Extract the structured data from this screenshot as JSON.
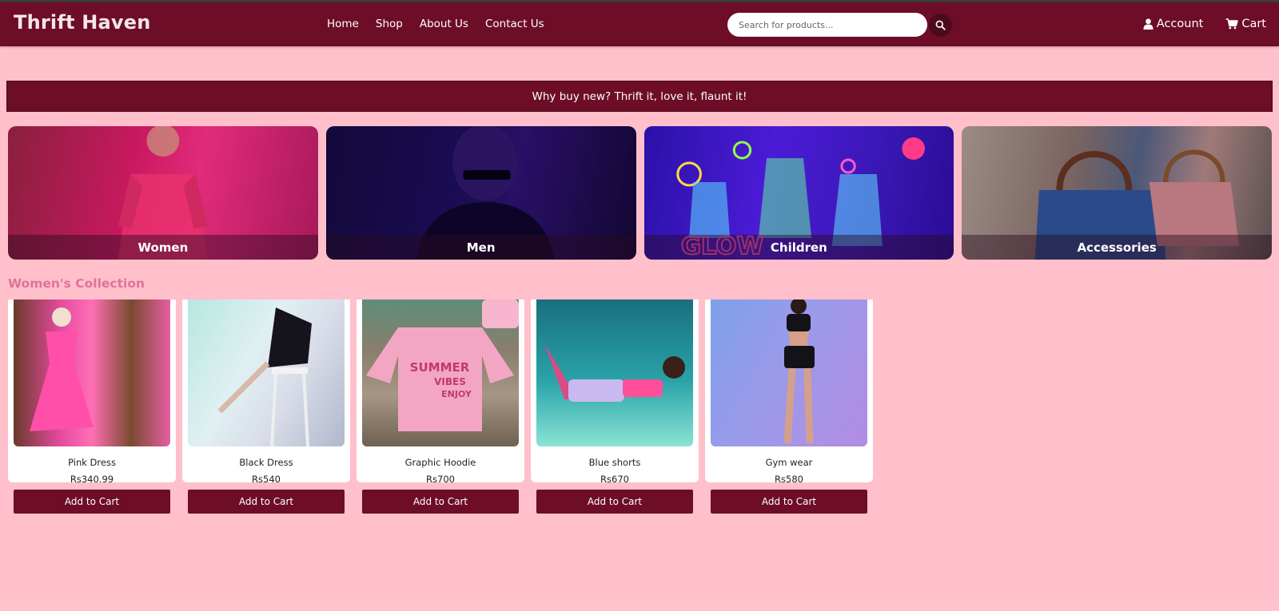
{
  "header": {
    "brand": "Thrift Haven",
    "nav": [
      "Home",
      "Shop",
      "About Us",
      "Contact Us"
    ],
    "search": {
      "placeholder": "Search for products...",
      "value": ""
    },
    "account_label": "Account",
    "cart_label": "Cart"
  },
  "banner": {
    "text": "Why buy new? Thrift it, love it, flaunt it!"
  },
  "categories": [
    {
      "label": "Women"
    },
    {
      "label": "Men"
    },
    {
      "label": "Children"
    },
    {
      "label": "Accessories"
    }
  ],
  "collection": {
    "title": "Women's Collection",
    "products": [
      {
        "name": "Pink Dress",
        "price": "Rs340.99",
        "button": "Add to Cart"
      },
      {
        "name": "Black Dress",
        "price": "Rs540",
        "button": "Add to Cart"
      },
      {
        "name": "Graphic Hoodie",
        "price": "Rs700",
        "button": "Add to Cart"
      },
      {
        "name": "Blue shorts",
        "price": "Rs670",
        "button": "Add to Cart"
      },
      {
        "name": "Gym wear",
        "price": "Rs580",
        "button": "Add to Cart"
      }
    ]
  },
  "hoodie_print": {
    "line1": "SUMMER",
    "line2": "VIBES",
    "line3": "ENJOY"
  },
  "children_sign": "GLOW",
  "colors": {
    "page_bg": "#ffc0cb",
    "primary": "#6d0d27",
    "section_title": "#e0729a"
  },
  "icons": [
    "search-icon",
    "user-icon",
    "cart-icon"
  ]
}
